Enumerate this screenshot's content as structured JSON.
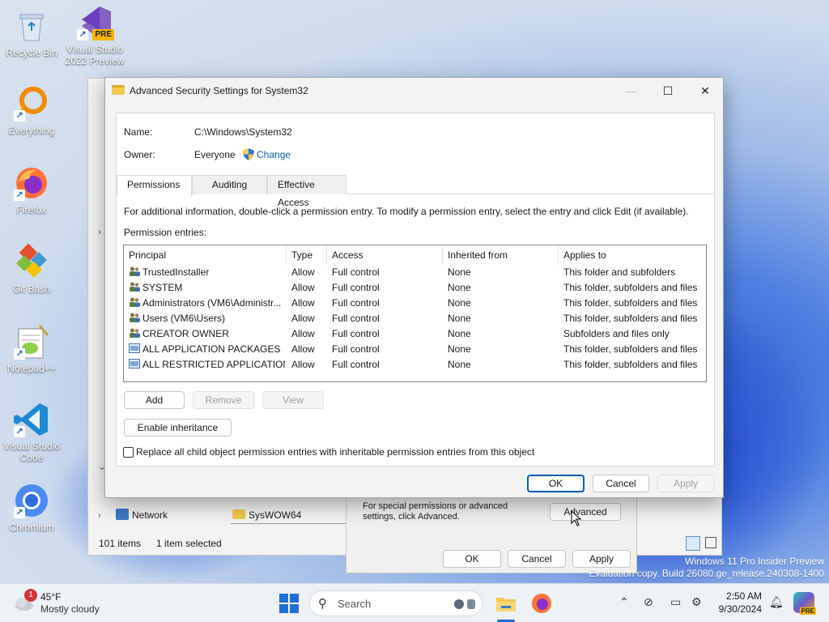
{
  "desktop": {
    "icons": [
      {
        "label": "Recycle Bin",
        "icon": "recycle-bin-icon"
      },
      {
        "label": "Visual Studio 2022 Preview",
        "icon": "visual-studio-preview-icon",
        "badge": "PRE"
      },
      {
        "label": "Everything",
        "icon": "everything-search-icon"
      },
      {
        "label": "Firefox",
        "icon": "firefox-icon"
      },
      {
        "label": "Git Bash",
        "icon": "git-bash-icon"
      },
      {
        "label": "Notepad++",
        "icon": "notepad-plus-plus-icon"
      },
      {
        "label": "Visual Studio Code",
        "icon": "vscode-icon"
      },
      {
        "label": "Chromium",
        "icon": "chromium-icon"
      }
    ],
    "watermark_line1": "Windows 11 Pro Insider Preview",
    "watermark_line2": "Evaluation copy. Build 26080.ge_release.240308-1400"
  },
  "explorer": {
    "nav_network": "Network",
    "folder_sysWOW64": "SysWOW64",
    "status_items": "101 items",
    "status_selected": "1 item selected"
  },
  "properties": {
    "advanced_hint": "For special permissions or advanced settings, click Advanced.",
    "advanced_button": "Advanced",
    "ok": "OK",
    "cancel": "Cancel",
    "apply": "Apply"
  },
  "dialog": {
    "title": "Advanced Security Settings for System32",
    "name_label": "Name:",
    "name_value": "C:\\Windows\\System32",
    "owner_label": "Owner:",
    "owner_value": "Everyone",
    "change_link": "Change",
    "tabs": [
      "Permissions",
      "Auditing",
      "Effective Access"
    ],
    "info_text": "For additional information, double-click a permission entry. To modify a permission entry, select the entry and click Edit (if available).",
    "entries_label": "Permission entries:",
    "columns": [
      "Principal",
      "Type",
      "Access",
      "Inherited from",
      "Applies to"
    ],
    "rows": [
      {
        "principal": "TrustedInstaller",
        "type": "Allow",
        "access": "Full control",
        "inherited": "None",
        "applies": "This folder and subfolders",
        "kind": "user"
      },
      {
        "principal": "SYSTEM",
        "type": "Allow",
        "access": "Full control",
        "inherited": "None",
        "applies": "This folder, subfolders and files",
        "kind": "user"
      },
      {
        "principal": "Administrators (VM6\\Administr...",
        "type": "Allow",
        "access": "Full control",
        "inherited": "None",
        "applies": "This folder, subfolders and files",
        "kind": "user"
      },
      {
        "principal": "Users (VM6\\Users)",
        "type": "Allow",
        "access": "Full control",
        "inherited": "None",
        "applies": "This folder, subfolders and files",
        "kind": "user"
      },
      {
        "principal": "CREATOR OWNER",
        "type": "Allow",
        "access": "Full control",
        "inherited": "None",
        "applies": "Subfolders and files only",
        "kind": "user"
      },
      {
        "principal": "ALL APPLICATION PACKAGES",
        "type": "Allow",
        "access": "Full control",
        "inherited": "None",
        "applies": "This folder, subfolders and files",
        "kind": "package"
      },
      {
        "principal": "ALL RESTRICTED APPLICATION ...",
        "type": "Allow",
        "access": "Full control",
        "inherited": "None",
        "applies": "This folder, subfolders and files",
        "kind": "package"
      }
    ],
    "add_button": "Add",
    "remove_button": "Remove",
    "view_button": "View",
    "enable_inheritance_button": "Enable inheritance",
    "replace_checkbox_label": "Replace all child object permission entries with inheritable permission entries from this object",
    "ok": "OK",
    "cancel": "Cancel",
    "apply": "Apply"
  },
  "taskbar": {
    "weather_temp": "45°F",
    "weather_desc": "Mostly cloudy",
    "weather_badge": "1",
    "search_placeholder": "Search",
    "time": "2:50 AM",
    "date": "9/30/2024",
    "copilot_badge": "PRE"
  }
}
